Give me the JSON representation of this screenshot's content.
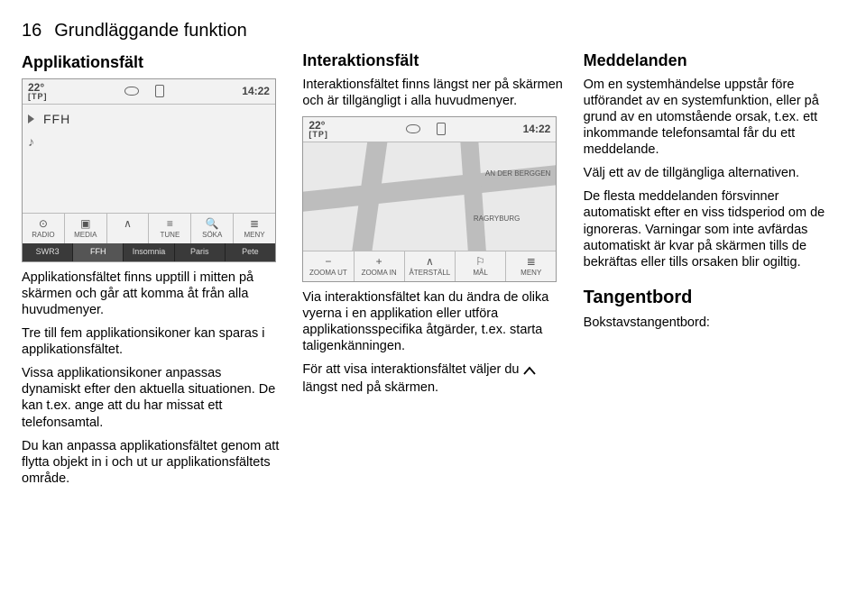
{
  "page_number": "16",
  "chapter_title": "Grundläggande funktion",
  "col1": {
    "heading": "Applikationsfält",
    "screen": {
      "temp": "22°",
      "tp": "[TP]",
      "clock": "14:22",
      "station": "FFH",
      "toolbar": [
        "RADIO",
        "MEDIA",
        "",
        "TUNE",
        "SÖKA",
        "MENY"
      ],
      "presets": [
        "SWR3",
        "FFH",
        "Insomnia",
        "Paris",
        "Pete"
      ]
    },
    "p1": "Applikationsfältet finns upptill i mitten på skärmen och går att komma åt från alla huvudmenyer.",
    "p2": "Tre till fem applikationsikoner kan sparas i applikationsfältet.",
    "p3": "Vissa applikationsikoner anpassas dynamiskt efter den aktuella situa­tionen. De kan t.ex. ange att du har missat ett telefonsamtal.",
    "p4": "Du kan anpassa applikationsfältet genom att flytta objekt in i och ut ur applikationsfältets område."
  },
  "col2": {
    "heading": "Interaktionsfält",
    "p1": "Interaktionsfältet finns längst ner på skärmen och är tillgängligt i alla hu­vudmenyer.",
    "screen": {
      "temp": "22°",
      "tp": "[TP]",
      "clock": "14:22",
      "map_label1": "AN DER BERGGEN",
      "map_label2": "RAGRYBURG",
      "toolbar": [
        "ZOOMA UT",
        "ZOOMA IN",
        "ÅTERSTÄLL",
        "MÅL",
        "MENY"
      ]
    },
    "p2": "Via interaktionsfältet kan du ändra de olika vyerna i en applikation eller ut­föra applikationsspecifika åtgärder, t.ex. starta taligenkänningen.",
    "p3a": "För att visa interaktionsfältet väljer du ",
    "p3b": " längst ned på skärmen."
  },
  "col3": {
    "heading1": "Meddelanden",
    "p1": "Om en systemhändelse uppstår före utförandet av en systemfunktion, eller på grund av en utomstående orsak, t.ex. ett inkommande telefonsamtal får du ett meddelande.",
    "p2": "Välj ett av de tillgängliga alternativen.",
    "p3": "De flesta meddelanden försvinner automatiskt efter en viss tidsperiod om de ignoreras. Varningar som inte avfärdas automatiskt är kvar på skärmen tills de bekräftas eller tills or­saken blir ogiltig.",
    "heading2": "Tangentbord",
    "p4": "Bokstavstangentbord:"
  }
}
